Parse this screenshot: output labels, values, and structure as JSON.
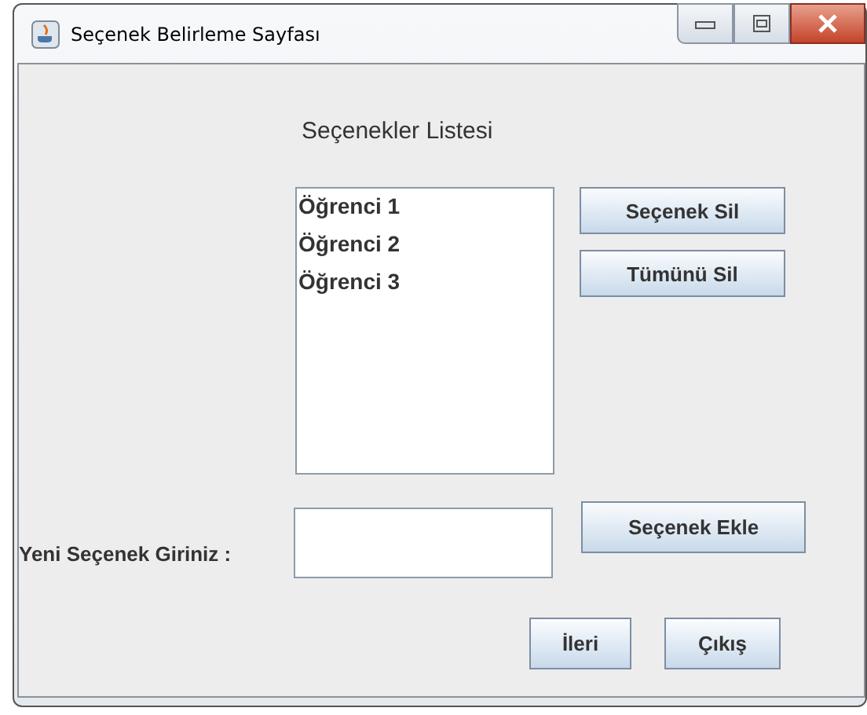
{
  "window": {
    "title": "Seçenek Belirleme Sayfası"
  },
  "list_title": "Seçenekler Listesi",
  "list": {
    "items": [
      "Öğrenci 1",
      "Öğrenci 2",
      "Öğrenci 3"
    ]
  },
  "list_buttons": [
    "Seçenek Sil",
    "Tümünü Sil"
  ],
  "new_option": {
    "label": "Yeni Seçenek Giriniz :",
    "button": "Seçenek Ekle"
  },
  "footer_buttons": [
    "İleri",
    "Çıkış"
  ]
}
